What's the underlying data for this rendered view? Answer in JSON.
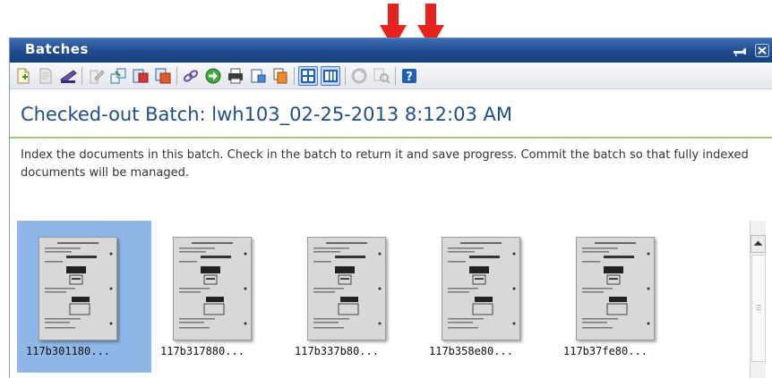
{
  "panel": {
    "title": "Batches",
    "controls": [
      "pin-icon",
      "close-icon"
    ]
  },
  "toolbar": {
    "buttons": [
      {
        "name": "new-document-icon",
        "enabled": true
      },
      {
        "name": "document-properties-icon",
        "enabled": false
      },
      {
        "name": "scan-icon",
        "enabled": true
      },
      {
        "name": "edit-document-icon",
        "enabled": false
      },
      {
        "name": "split-document-icon",
        "enabled": true
      },
      {
        "name": "move-pages-icon",
        "enabled": true
      },
      {
        "name": "merge-pages-icon",
        "enabled": true
      },
      {
        "name": "link-icon",
        "enabled": true
      },
      {
        "name": "next-icon",
        "enabled": true
      },
      {
        "name": "print-icon",
        "enabled": true
      },
      {
        "name": "import-icon",
        "enabled": true
      },
      {
        "name": "copy-icon",
        "enabled": true
      },
      {
        "name": "thumbnail-view-icon",
        "enabled": true,
        "active": true
      },
      {
        "name": "list-view-icon",
        "enabled": true,
        "active": true
      },
      {
        "name": "refresh-icon",
        "enabled": false
      },
      {
        "name": "search-icon",
        "enabled": false
      },
      {
        "name": "help-icon",
        "enabled": true,
        "label": "?"
      }
    ]
  },
  "main": {
    "heading": "Checked-out Batch: lwh103_02-25-2013 8:12:03 AM",
    "instructions": "Index the documents in this batch. Check in the batch to return it and save progress. Commit the batch so that fully indexed documents will be managed."
  },
  "thumbnails": [
    {
      "caption": "117b301180...",
      "selected": true
    },
    {
      "caption": "117b317880...",
      "selected": false
    },
    {
      "caption": "117b337b80...",
      "selected": false
    },
    {
      "caption": "117b358e80...",
      "selected": false
    },
    {
      "caption": "117b37fe80...",
      "selected": false
    }
  ],
  "annotations": {
    "arrow_color": "#e8231f",
    "arrow_targets": [
      "thumbnail-view-icon",
      "list-view-icon"
    ]
  },
  "colors": {
    "titlebar": "#1e4a8f",
    "heading": "#1f4d8c",
    "selection": "#8eb6e6",
    "divider": "#a9c77a"
  }
}
